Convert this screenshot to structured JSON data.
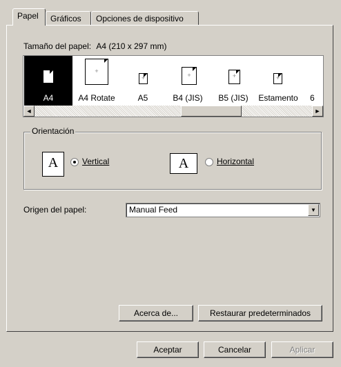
{
  "tabs": [
    {
      "label": "Papel"
    },
    {
      "label": "Gráficos"
    },
    {
      "label": "Opciones de dispositivo"
    }
  ],
  "paper_size": {
    "label": "Tamaño del papel:",
    "value": "A4 (210 x 297 mm)"
  },
  "paper_items": [
    {
      "label": "A4",
      "selected": true
    },
    {
      "label": "A4 Rotate"
    },
    {
      "label": "A5"
    },
    {
      "label": "B4 (JIS)"
    },
    {
      "label": "B5 (JIS)"
    },
    {
      "label": "Estamento"
    },
    {
      "label": "6"
    }
  ],
  "orientation": {
    "title": "Orientación",
    "icon_letter": "A",
    "vertical_label": "Vertical",
    "horizontal_label": "Horizontal",
    "selected": "vertical"
  },
  "paper_source": {
    "label": "Origen del papel:",
    "value": "Manual Feed"
  },
  "buttons": {
    "about": "Acerca de...",
    "restore": "Restaurar predeterminados",
    "ok": "Aceptar",
    "cancel": "Cancelar",
    "apply": "Aplicar"
  },
  "icons": {
    "scroll_left": "◄",
    "scroll_right": "►",
    "dropdown": "▼"
  }
}
